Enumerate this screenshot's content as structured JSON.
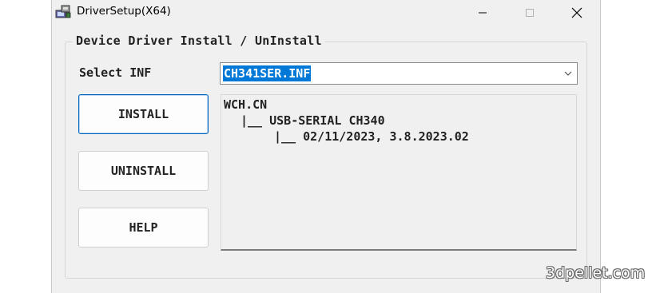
{
  "window": {
    "title": "DriverSetup(X64)",
    "app_icon": "driver-setup-icon",
    "controls": {
      "minimize": "—",
      "maximize": "☐",
      "close": "✕"
    }
  },
  "group": {
    "legend": "Device Driver Install / UnInstall"
  },
  "select_inf": {
    "label": "Select INF",
    "value": "CH341SER.INF"
  },
  "buttons": {
    "install": "INSTALL",
    "uninstall": "UNINSTALL",
    "help": "HELP"
  },
  "info_tree": {
    "lines": [
      "WCH.CN",
      "|__ USB-SERIAL CH340",
      "|__ 02/11/2023, 3.8.2023.02"
    ]
  },
  "watermark": "3dpellet.com",
  "colors": {
    "selection": "#0078d7",
    "window_bg": "#f0f0f0",
    "focus_border": "#0067c0"
  }
}
